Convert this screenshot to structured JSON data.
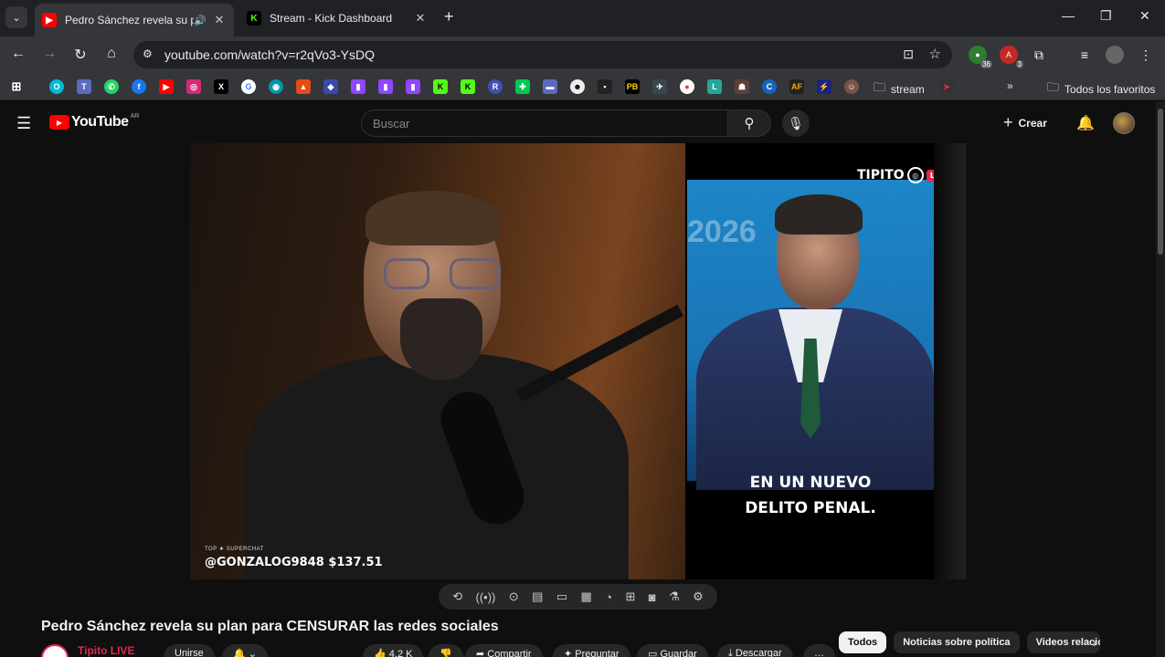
{
  "browser": {
    "tabs": [
      {
        "title": "Pedro Sánchez revela su pla",
        "favicon": "youtube-icon",
        "active": true,
        "audio": true
      },
      {
        "title": "Stream - Kick Dashboard",
        "favicon": "kick-icon",
        "active": false
      }
    ],
    "url": "youtube.com/watch?v=r2qVo3-YsDQ",
    "extensions": [
      {
        "name": "green-extension-icon",
        "badge": "36"
      },
      {
        "name": "red-extension-icon",
        "badge": "3"
      }
    ],
    "bookmarks_folder": "stream",
    "all_bookmarks": "Todos los favoritos"
  },
  "youtube": {
    "logo_text": "YouTube",
    "country_code": "AR",
    "search_placeholder": "Buscar",
    "create_label": "Crear"
  },
  "video": {
    "superchat_top": "TOP ★ SUPERCHAT",
    "superchat_text": "@GONZALOG9848 $137.51",
    "overlay_logo": "TIPITO",
    "overlay_live": "LIVE",
    "background_text": "2026",
    "caption_line1": "EN UN NUEVO",
    "caption_line2": "DELITO PENAL.",
    "title": "Pedro Sánchez revela su plan para CENSURAR las redes sociales"
  },
  "channel": {
    "name": "Tipito LIVE",
    "join_label": "Unirse",
    "likes": "4,2 K",
    "share_label": "Compartir",
    "ask_label": "Preguntar",
    "save_label": "Guardar",
    "download_label": "Descargar"
  },
  "chips": [
    {
      "label": "Todos",
      "selected": true
    },
    {
      "label": "Noticias sobre política",
      "selected": false
    },
    {
      "label": "Videos relacionados",
      "selected": false
    }
  ],
  "colors": {
    "youtube_red": "#ff0000",
    "kick_green": "#53fc18",
    "tipito_pink": "#e02850"
  }
}
